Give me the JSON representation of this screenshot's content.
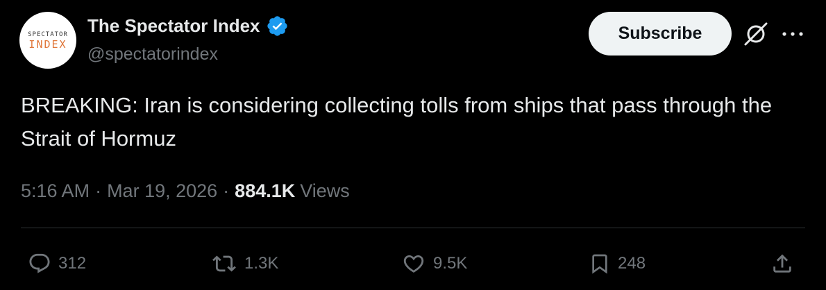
{
  "account": {
    "avatar_line1": "SPECTATOR",
    "avatar_line2": "INDEX",
    "display_name": "The Spectator Index",
    "handle": "@spectatorindex",
    "verified_icon": "verified-badge-icon",
    "verified_color": "#1d9bf0"
  },
  "header": {
    "subscribe_label": "Subscribe",
    "grok_icon": "grok-icon",
    "more_icon": "more-options-icon"
  },
  "tweet": {
    "text": "BREAKING: Iran is considering collecting tolls from ships that pass through the Strait of Hormuz",
    "time": "5:16 AM",
    "separator": "·",
    "date": "Mar 19, 2026",
    "views_count": "884.1K",
    "views_label": "Views"
  },
  "actions": {
    "replies": "312",
    "reposts": "1.3K",
    "likes": "9.5K",
    "bookmarks": "248",
    "icons": [
      "reply-icon",
      "repost-icon",
      "like-icon",
      "bookmark-icon",
      "share-icon"
    ]
  },
  "colors": {
    "background": "#000000",
    "primary_text": "#e7e9ea",
    "secondary_text": "#71767b",
    "divider": "#2f3336",
    "button_bg": "#eff3f4",
    "avatar_accent": "#e0773a"
  }
}
